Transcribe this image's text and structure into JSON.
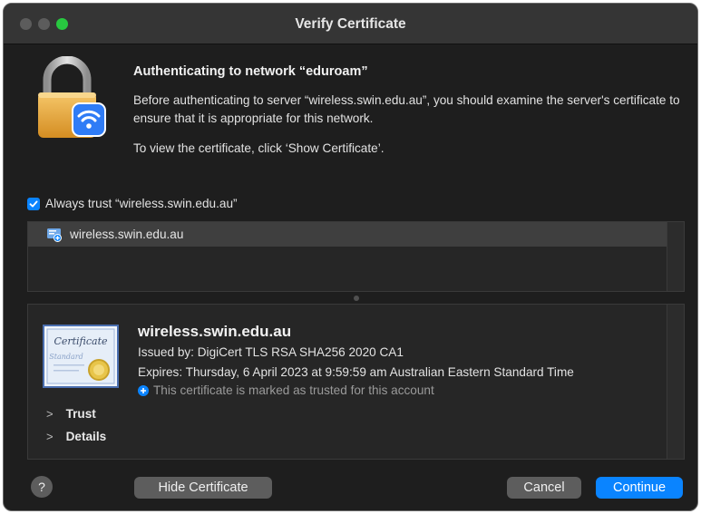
{
  "window": {
    "title": "Verify Certificate"
  },
  "header": {
    "heading": "Authenticating to network “eduroam”",
    "description": "Before authenticating to server “wireless.swin.edu.au”, you should examine the server's certificate to ensure that it is appropriate for this network.",
    "instruction": "To view the certificate, click ‘Show Certificate’."
  },
  "always_trust": {
    "label": "Always trust “wireless.swin.edu.au”",
    "checked": true
  },
  "certificate_list": {
    "items": [
      {
        "label": "wireless.swin.edu.au",
        "selected": true
      }
    ]
  },
  "details": {
    "name": "wireless.swin.edu.au",
    "issued_by": "Issued by: DigiCert TLS RSA SHA256 2020 CA1",
    "expires": "Expires: Thursday, 6 April 2023 at 9:59:59 am Australian Eastern Standard Time",
    "trusted_note": "This certificate is marked as trusted for this account",
    "sections": [
      "Trust",
      "Details"
    ],
    "cert_icon_text": [
      "Certificate",
      "Standard"
    ]
  },
  "buttons": {
    "help": "?",
    "hide_certificate": "Hide Certificate",
    "cancel": "Cancel",
    "continue": "Continue"
  },
  "icons": {
    "lock": "lock-wifi-icon",
    "checkbox": "checkmark-icon",
    "cert_small": "certificate-small-icon",
    "cert_large": "certificate-icon",
    "trusted": "plus-circle-icon",
    "disclosure": "chevron-right-icon"
  },
  "colors": {
    "accent": "#0a84ff",
    "window_bg": "#1e1e1e",
    "titlebar_bg": "#353535",
    "zoom_green": "#28c840"
  }
}
